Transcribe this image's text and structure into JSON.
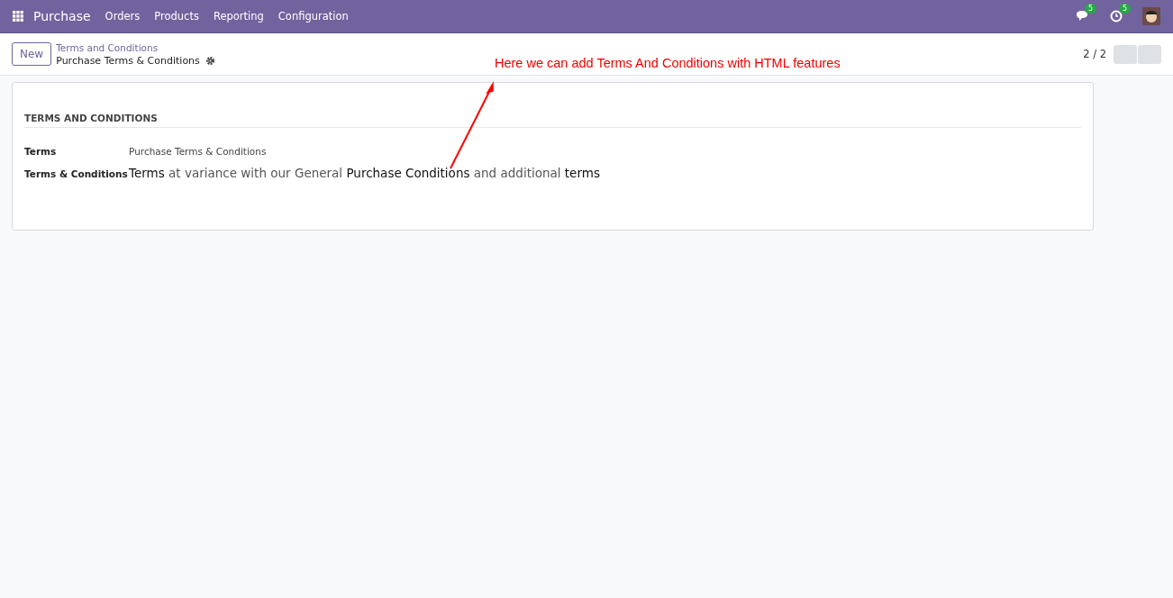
{
  "navbar": {
    "app": "Purchase",
    "menu": [
      "Orders",
      "Products",
      "Reporting",
      "Configuration"
    ],
    "messages_badge": "5",
    "activities_badge": "5"
  },
  "control_panel": {
    "new_button": "New",
    "breadcrumb_parent": "Terms and Conditions",
    "breadcrumb_current": "Purchase Terms & Conditions",
    "pager": "2 / 2"
  },
  "annotation": "Here we can add Terms And Conditions with HTML features",
  "form": {
    "section_title": "TERMS AND CONDITIONS",
    "fields": [
      {
        "kind": "text",
        "label": "Terms",
        "value": "Purchase Terms & Conditions"
      },
      {
        "kind": "html",
        "label": "Terms & Conditions",
        "segments": [
          {
            "text": "Terms",
            "dark": true
          },
          {
            "text": "at variance with our General",
            "dark": false
          },
          {
            "text": "Purchase Conditions",
            "dark": true
          },
          {
            "text": "and additional",
            "dark": false
          },
          {
            "text": "terms",
            "dark": true
          }
        ]
      }
    ]
  }
}
